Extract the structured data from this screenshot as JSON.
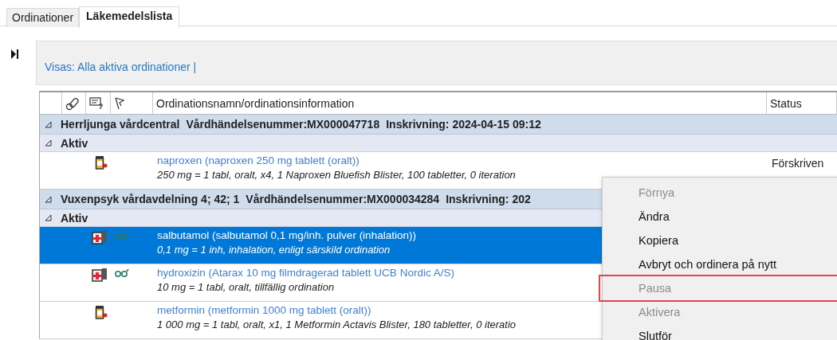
{
  "tabs": [
    {
      "label": "Ordinationer",
      "selected": false
    },
    {
      "label": "Läkemedelslista",
      "selected": true
    }
  ],
  "filter_bar": {
    "text": "Visas: Alla aktiva ordinationer |"
  },
  "table": {
    "columns": [
      {
        "kind": "blank"
      },
      {
        "kind": "pills-icon"
      },
      {
        "kind": "note-icon"
      },
      {
        "kind": "flag-icon"
      },
      {
        "kind": "text",
        "label": "Ordinationsnamn/ordinationsinformation"
      },
      {
        "kind": "text",
        "label": "Status"
      }
    ],
    "rows": [
      {
        "kind": "group",
        "expanded": true,
        "parts": [
          "Herrljunga vårdcentral",
          "Vårdhändelsenummer:MX000047718",
          "Inskrivning: 2024-04-15 09:12"
        ]
      },
      {
        "kind": "subgroup",
        "expanded": true,
        "label": "Aktiv"
      },
      {
        "kind": "drug-bottle",
        "glasses": false,
        "selected": false,
        "name": "naproxen (naproxen 250 mg tablett (oralt))",
        "detail": "250 mg = 1 tabl, oralt, x4, 1 Naproxen Bluefish Blister, 100 tabletter, 0 iteration",
        "status": "Förskriven"
      },
      {
        "kind": "group",
        "expanded": true,
        "parts": [
          "Vuxenpsyk vårdavdelning 4; 42; 1",
          "Vårdhändelsenummer:MX000034284",
          "Inskrivning: 202"
        ]
      },
      {
        "kind": "subgroup",
        "expanded": true,
        "label": "Aktiv"
      },
      {
        "kind": "drug-package",
        "glasses": true,
        "selected": true,
        "name": "salbutamol (salbutamol 0,1 mg/inh. pulver (inhalation))",
        "detail": "0,1 mg = 1 inh, inhalation, enligt särskild ordination"
      },
      {
        "kind": "drug-package",
        "glasses": true,
        "selected": false,
        "name": "hydroxizin (Atarax 10 mg filmdragerad tablett UCB Nordic A/S)",
        "detail": "10 mg = 1 tabl, oralt, tillfällig ordination"
      },
      {
        "kind": "drug-bottle",
        "glasses": false,
        "selected": false,
        "name": "metformin (metformin 1000 mg tablett (oralt))",
        "detail": "1 000 mg = 1 tabl, oralt, x1, 1 Metformin Actavis Blister, 180 tabletter, 0 iteratio"
      }
    ]
  },
  "context_menu": {
    "items": [
      {
        "label": "Förnya",
        "disabled": true,
        "highlighted": false
      },
      {
        "label": "Ändra",
        "disabled": false,
        "highlighted": false
      },
      {
        "label": "Kopiera",
        "disabled": false,
        "highlighted": false
      },
      {
        "label": "Avbryt och ordinera på nytt",
        "disabled": false,
        "highlighted": false
      },
      {
        "label": "Pausa",
        "disabled": true,
        "highlighted": true
      },
      {
        "label": "Aktivera",
        "disabled": true,
        "highlighted": false
      },
      {
        "label": "Slutför",
        "disabled": false,
        "highlighted": false
      }
    ]
  }
}
